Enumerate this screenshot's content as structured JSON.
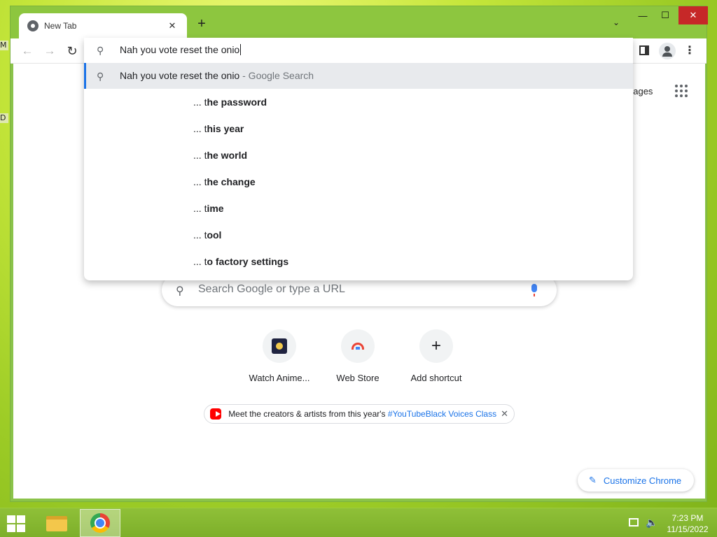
{
  "window": {
    "tab_title": "New Tab",
    "tab_close": "✕",
    "new_tab": "+",
    "tab_list": "⌄",
    "minimize": "—",
    "maximize": "☐",
    "close": "✕"
  },
  "toolbar": {
    "back": "←",
    "forward": "→",
    "reload": "↻",
    "menu": "⋮"
  },
  "omnibox": {
    "value": "Nah you vote reset the onio",
    "search_icon": "search-icon"
  },
  "suggestions": {
    "main": {
      "text": "Nah you vote reset the onio",
      "suffix": " - Google Search"
    },
    "items": [
      {
        "prefix": "... ",
        "plain": "t",
        "bold": "he password"
      },
      {
        "prefix": "... ",
        "plain": "t",
        "bold": "his year"
      },
      {
        "prefix": "... ",
        "plain": "t",
        "bold": "he world"
      },
      {
        "prefix": "... ",
        "plain": "t",
        "bold": "he change"
      },
      {
        "prefix": "... ",
        "plain": "t",
        "bold": "ime"
      },
      {
        "prefix": "... ",
        "plain": "t",
        "bold": "ool"
      },
      {
        "prefix": "... ",
        "plain": "t",
        "bold": "o factory settings"
      }
    ]
  },
  "ntp": {
    "images_link": "nages",
    "search_placeholder": "Search Google or type a URL",
    "shortcuts": [
      {
        "label": "Watch Anime..."
      },
      {
        "label": "Web Store"
      },
      {
        "label": "Add shortcut"
      }
    ],
    "promo": {
      "text": "Meet the creators & artists from this year's ",
      "link": "#YouTubeBlack Voices Class",
      "close": "✕"
    },
    "customize_label": "Customize Chrome"
  },
  "taskbar": {
    "time": "7:23 PM",
    "date": "11/15/2022"
  },
  "desktop": {
    "glyph_top": "M",
    "glyph_mid": "D"
  },
  "colors": {
    "accent": "#1a73e8",
    "desktop_green": "#9dcc26",
    "close_red": "#c62828"
  }
}
